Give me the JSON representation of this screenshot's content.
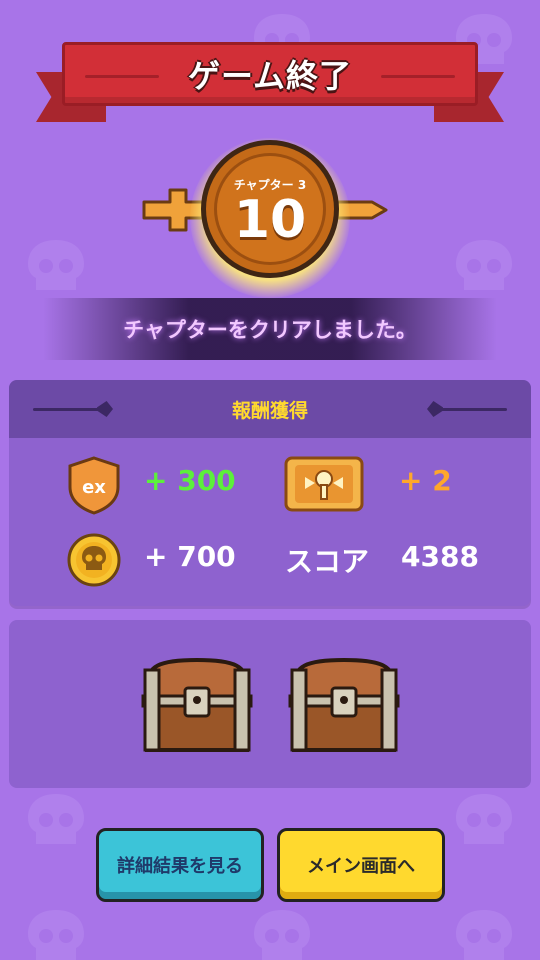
{
  "title": "ゲーム終了",
  "chapter": {
    "label": "チャプター 3",
    "number": "10"
  },
  "clear_message": "チャプターをクリアしました。",
  "rewards": {
    "header": "報酬獲得",
    "exp": {
      "icon": "ex",
      "value": "+ 300"
    },
    "ticket": {
      "value": "+ 2"
    },
    "gold": {
      "value": "+ 700"
    },
    "score": {
      "label": "スコア",
      "value": "4388"
    }
  },
  "chests": [
    {
      "icon": "treasure-chest-icon"
    },
    {
      "icon": "treasure-chest-icon"
    }
  ],
  "buttons": {
    "detail": "詳細結果を見る",
    "main": "メイン画面へ"
  },
  "colors": {
    "background": "#a874e8",
    "ribbon": "#d22f37",
    "medal": "#d0731c",
    "reward_title": "#ffd92e",
    "exp_value": "#5cf03a",
    "ticket_value": "#ffa72b",
    "detail_button": "#3cc4d8",
    "main_button": "#ffd92e"
  }
}
